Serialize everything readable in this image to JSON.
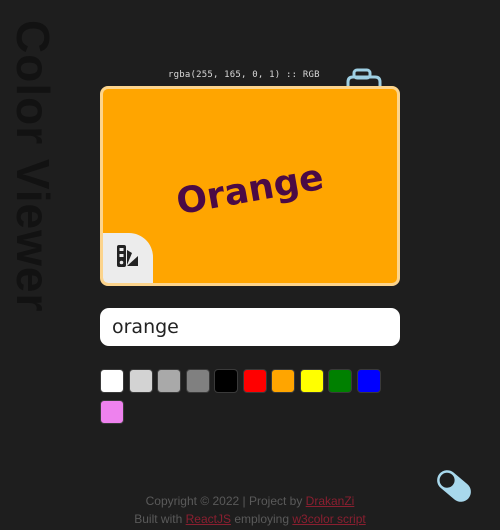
{
  "app": {
    "title": "Color Viewer"
  },
  "display": {
    "color_code": "rgba(255, 165, 0, 1) :: RGB",
    "color_name": "Orange",
    "background": "#ffa500",
    "name_color": "#4b0a45",
    "border_color": "#fcd48c"
  },
  "icons": {
    "copy": "clipboard-icon",
    "palette": "palette-icon",
    "toggle": "toggle-icon"
  },
  "search": {
    "value": "orange"
  },
  "swatches": [
    {
      "color": "#ffffff"
    },
    {
      "color": "#d3d3d3"
    },
    {
      "color": "#a9a9a9"
    },
    {
      "color": "#808080"
    },
    {
      "color": "#000000"
    },
    {
      "color": "#ff0000"
    },
    {
      "color": "#ffa500"
    },
    {
      "color": "#ffff00"
    },
    {
      "color": "#008000"
    },
    {
      "color": "#0000ff"
    },
    {
      "color": "#ee82ee"
    }
  ],
  "footer": {
    "copyright": "Copyright © 2022 | Project by",
    "author": "DrakanZi",
    "built_with": "Built with",
    "framework": "ReactJS",
    "employing": "employing",
    "script": "w3color script"
  }
}
